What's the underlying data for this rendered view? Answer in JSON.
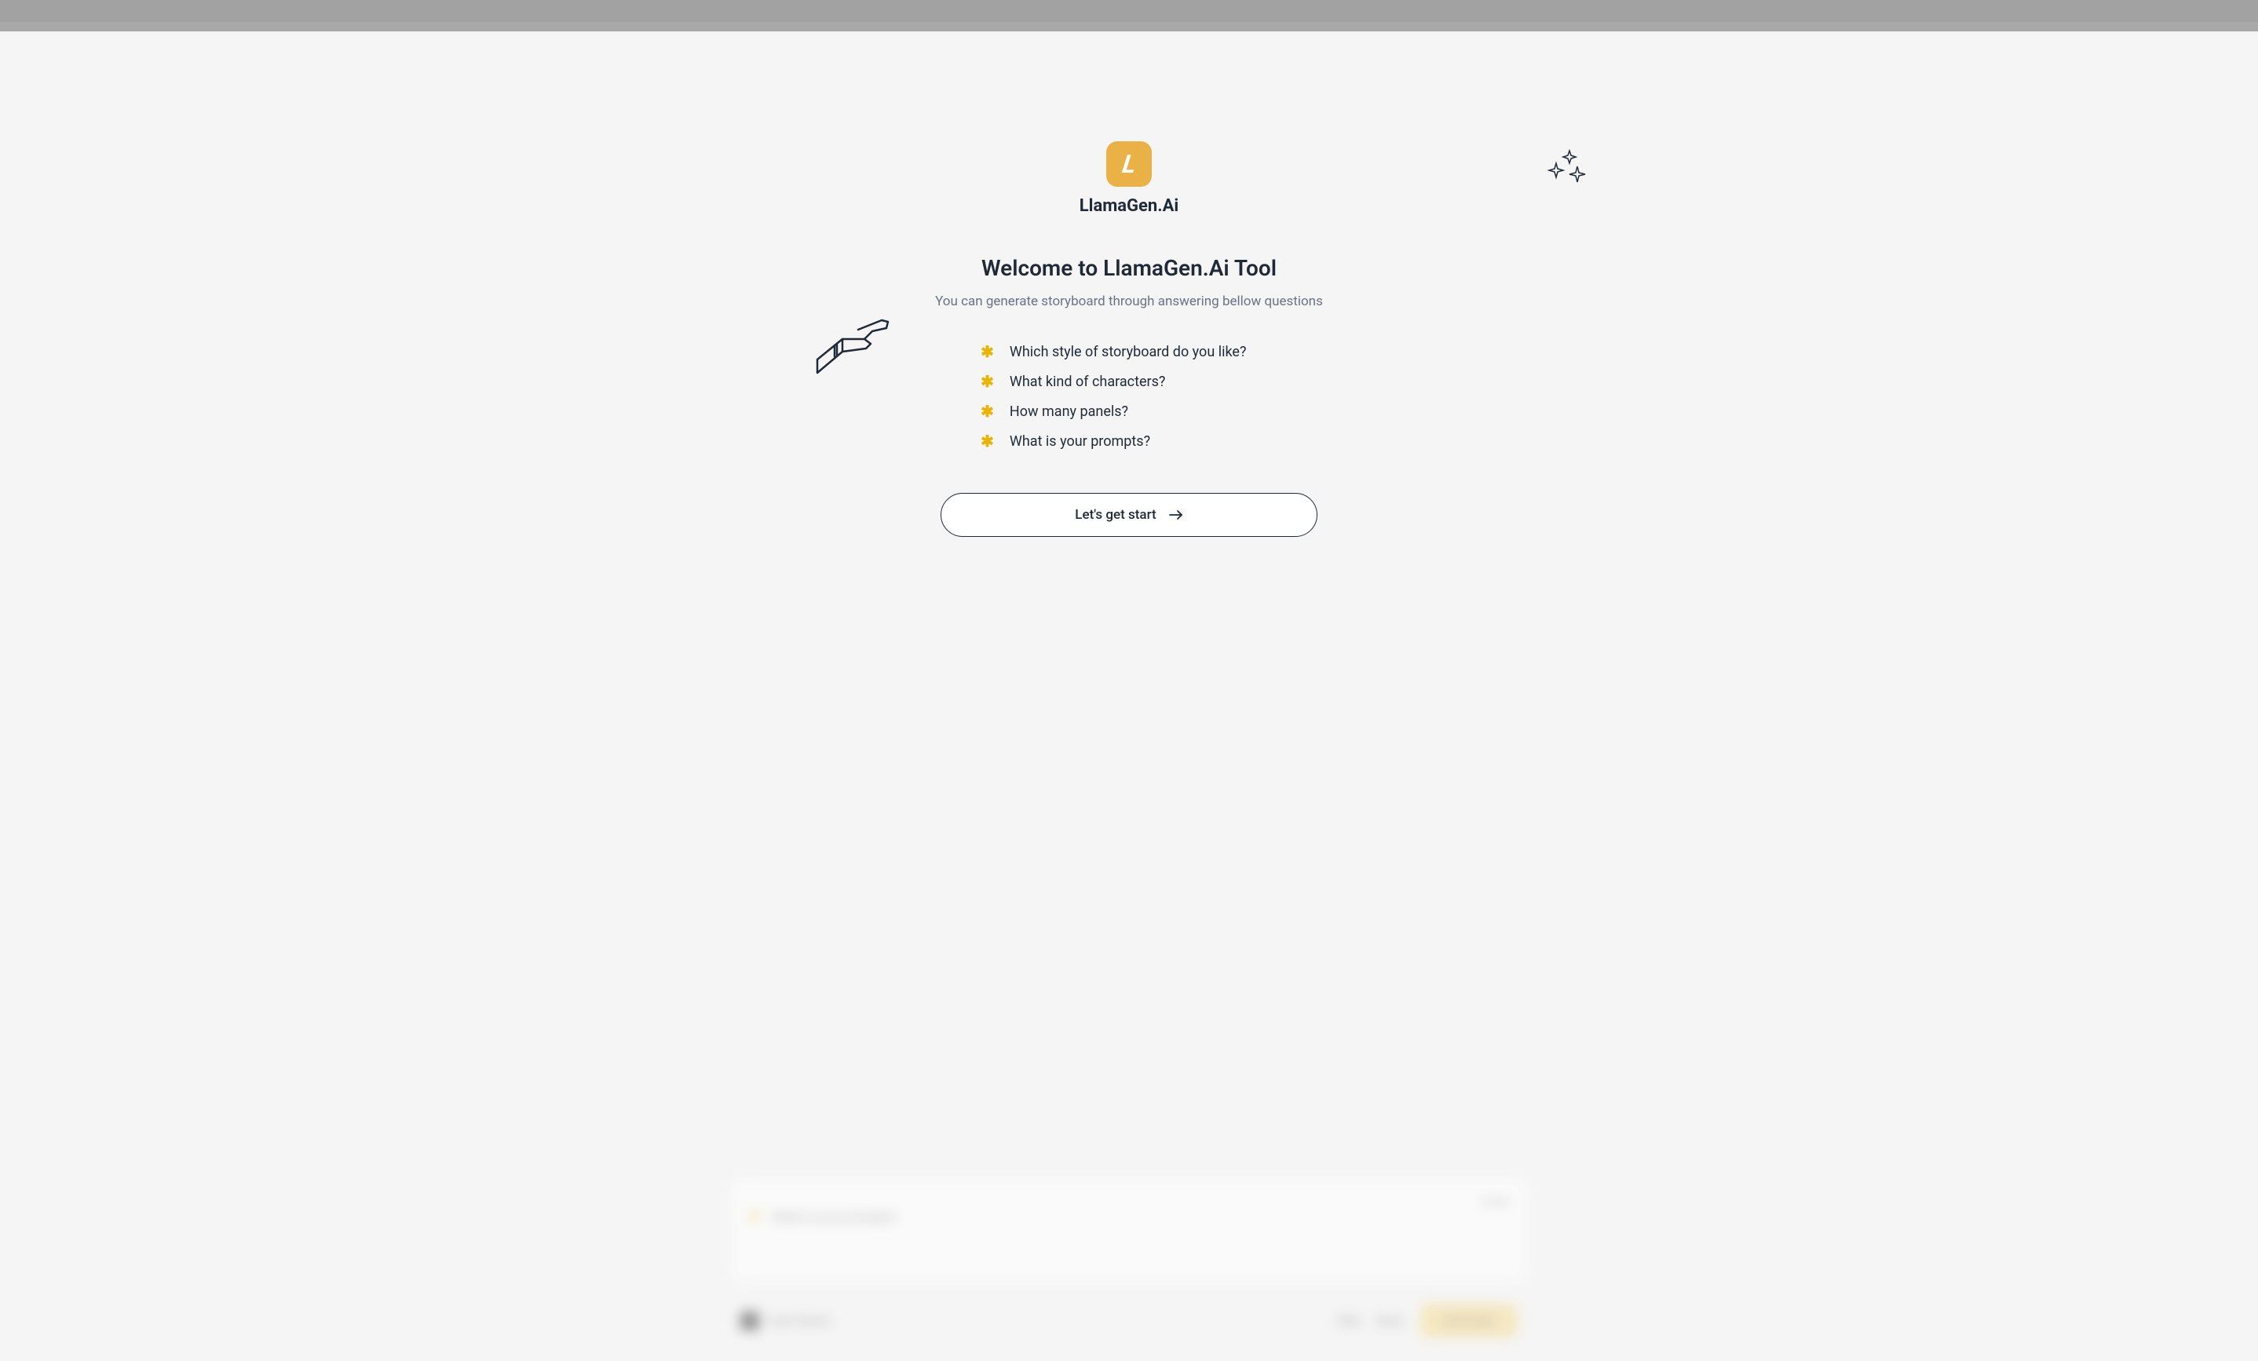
{
  "brand": {
    "name": "LlamaGen.Ai",
    "logo_letter": "L"
  },
  "welcome": {
    "title": "Welcome to LlamaGen.Ai Tool",
    "subtitle": "You can generate storyboard through answering bellow questions"
  },
  "questions": [
    "Which style of storyboard do you like?",
    "What kind of characters?",
    "How many panels?",
    "What is your prompts?"
  ],
  "cta": {
    "label": "Let's get start"
  },
  "blurred": {
    "question_label": "What is your prompts?",
    "counter": "0/600",
    "user_label": "User Name",
    "skip": "Skip",
    "back": "Back",
    "generate": "Generate"
  }
}
